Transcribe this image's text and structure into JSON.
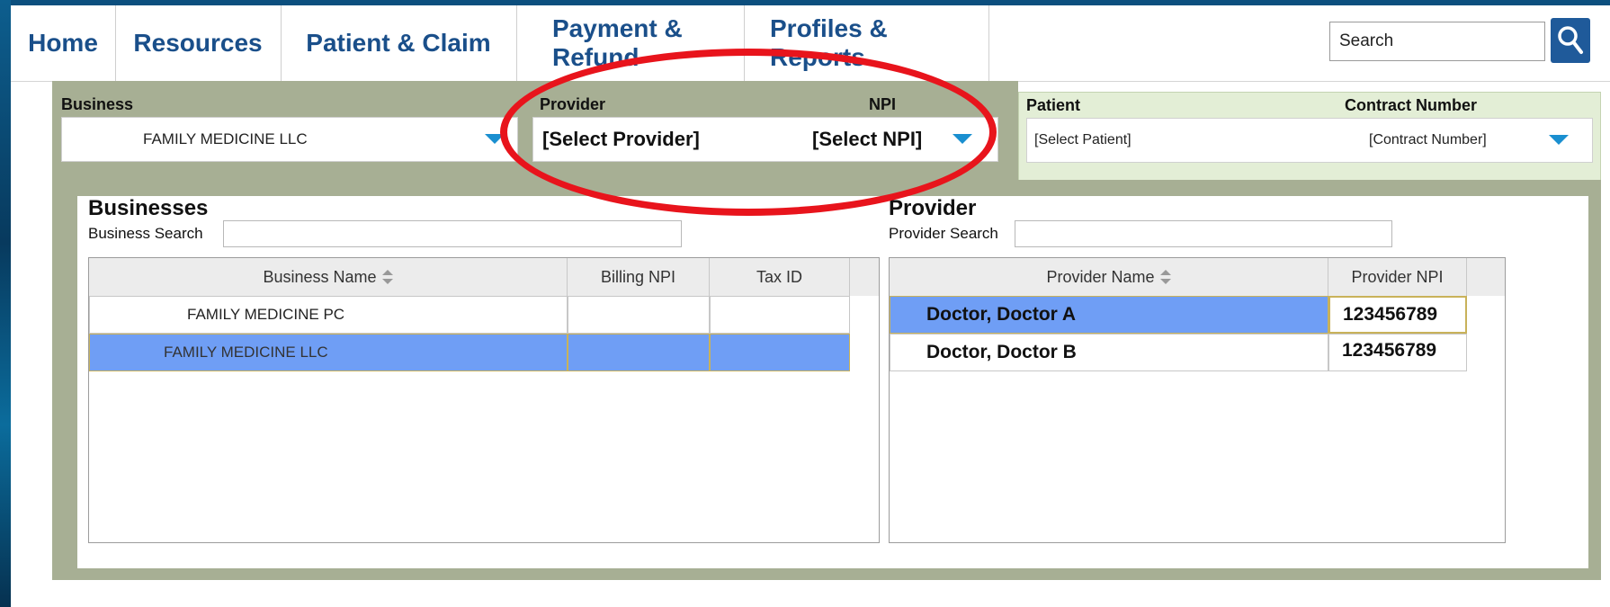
{
  "nav": {
    "items": [
      "Home",
      "Resources",
      "Patient & Claim",
      "Payment & Refund",
      "Profiles & Reports"
    ],
    "search_value": "Search"
  },
  "selectors": {
    "business_label": "Business",
    "business_value": "FAMILY MEDICINE LLC",
    "provider_label": "Provider",
    "provider_value": "[Select Provider]",
    "npi_label": "NPI",
    "npi_value": "[Select NPI]",
    "patient_label": "Patient",
    "patient_value": "[Select Patient]",
    "contract_label": "Contract Number",
    "contract_value": "[Contract Number]"
  },
  "businesses": {
    "title": "Businesses",
    "search_label": "Business Search",
    "columns": [
      "Business Name",
      "Billing NPI",
      "Tax ID"
    ],
    "rows": [
      {
        "name": "FAMILY MEDICINE PC",
        "npi": "",
        "tax_id": "",
        "selected": false
      },
      {
        "name": "FAMILY MEDICINE LLC",
        "npi": "",
        "tax_id": "",
        "selected": true
      }
    ]
  },
  "providers": {
    "title": "Provider",
    "search_label": "Provider Search",
    "columns": [
      "Provider Name",
      "Provider NPI"
    ],
    "rows": [
      {
        "name": "Doctor, Doctor A",
        "npi": "123456789",
        "selected": true
      },
      {
        "name": "Doctor, Doctor B",
        "npi": "123456789",
        "selected": false
      }
    ]
  },
  "colors": {
    "nav_text": "#1a4f8a",
    "band": "#a7af94",
    "selection": "#6f9ef5",
    "annotation": "#e8141c"
  }
}
